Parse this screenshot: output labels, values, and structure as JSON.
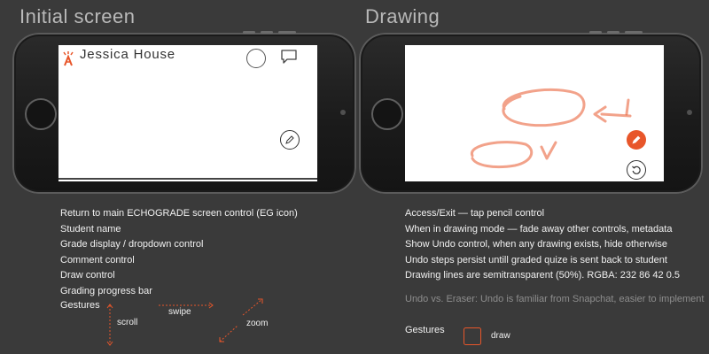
{
  "titles": {
    "initial": "Initial screen",
    "drawing": "Drawing"
  },
  "initial_screen": {
    "student_name": "Jessica House",
    "icons": [
      "echograde-logo-icon",
      "grade-circle-icon",
      "comment-bubble-icon",
      "pencil-icon"
    ]
  },
  "drawing_screen": {
    "icons": [
      "pencil-icon",
      "undo-icon"
    ],
    "stroke_color": "rgba(232,86,42,0.5)",
    "accent_color": "#e8562a"
  },
  "left_descriptions": [
    "Return to main ECHOGRADE screen control (EG icon)",
    "Student name",
    "Grade display / dropdown control",
    "Comment control",
    "Draw control",
    "Grading progress bar"
  ],
  "left_gestures": {
    "label": "Gestures",
    "scroll": "scroll",
    "swipe": "swipe",
    "zoom": "zoom"
  },
  "right_descriptions": [
    "Access/Exit — tap pencil control",
    "When in drawing mode — fade away other controls, metadata",
    "Show Undo control, when any drawing exists, hide otherwise",
    "Undo steps persist untill graded quize is sent back to student",
    "Drawing lines are semitransparent (50%). RGBA: 232 86 42 0.5"
  ],
  "right_note": "Undo vs. Eraser: Undo is familiar from Snapchat, easier to implement",
  "right_gestures": {
    "label": "Gestures",
    "draw": "draw"
  }
}
